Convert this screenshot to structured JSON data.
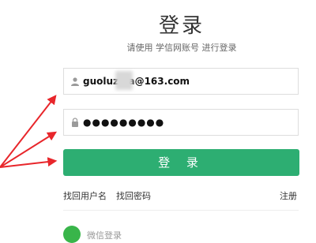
{
  "page": {
    "title": "登录",
    "subtitle": "请使用 学信网账号 进行登录"
  },
  "form": {
    "username_value": "guoluzi  a@163.com",
    "password_value": "●●●●●●●●●",
    "login_label": "登 录"
  },
  "links": {
    "find_username": "找回用户名",
    "find_password": "找回密码",
    "register": "注册"
  },
  "third_party": {
    "wechat_label": "微信登录"
  },
  "icons": {
    "user": "user-icon",
    "lock": "lock-icon",
    "wechat": "wechat-icon"
  },
  "colors": {
    "accent": "#2dae72",
    "annotation": "#e8262b"
  }
}
